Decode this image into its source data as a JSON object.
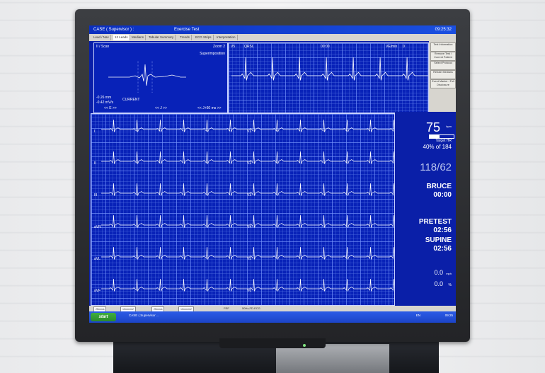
{
  "window": {
    "title_left": "CASE ( Supervisor ) :",
    "title_center": "Exercise Test",
    "clock": "09:25:32"
  },
  "tabs": [
    "Lead / Nav",
    "12 Leads",
    "Medians",
    "Tabular Summary",
    "Trends",
    "ECG Strips",
    "Interpretation"
  ],
  "sidebar_buttons": [
    "Test Information",
    "Remove Test / Current Patient",
    "Select Protocol",
    "Retrain Medians",
    "Event Marker / Full Disclosure"
  ],
  "top_left_panel": {
    "title": "II / Scan",
    "zoom": "Zoom 2",
    "superimposition": "Superimposition",
    "readout1": "-0.26 mm",
    "readout2": "-0.42 mV/s",
    "current": "CURRENT",
    "nav_e": "<<  E  >>",
    "nav_j": "<<  J  >>",
    "nav_j60": "<<  J+60 ms  >>"
  },
  "top_right_panel": {
    "lead": "V5",
    "qrs": "QRSL",
    "time": "00:00",
    "ve": "VE/min",
    "ve_value": "0"
  },
  "leads": [
    "I",
    "II",
    "III",
    "aVR",
    "aVL",
    "aVF"
  ],
  "lead_markers": [
    "V1",
    "V2",
    "V3",
    "V4",
    "V5",
    "V6"
  ],
  "vitals": {
    "heart_rate": "75",
    "hr_unit": "bpm",
    "target_label": "Target HR",
    "target_value": "40% of 184",
    "bp": "118/62",
    "protocol": "BRUCE",
    "protocol_time": "00:00",
    "stage": "PRETEST",
    "stage_time": "02:56",
    "position": "SUPINE",
    "position_time": "02:56",
    "speed": "0.0",
    "speed_unit": "mph",
    "grade": "0.0",
    "grade_unit": "%"
  },
  "status": {
    "combo1": "25mm/s",
    "combo2": "10mm/mV",
    "combo3": "25mm/s",
    "combo4": "10mm/mV",
    "filter": "FRF",
    "filter2": "50Hz,FD-ECG"
  },
  "taskbar": {
    "start": "start",
    "task": "CASE ( Supervisor ...",
    "lang": "EN",
    "time": "09:25"
  },
  "colors": {
    "screen_bg": "#0a1fa8",
    "trace": "#ffffff",
    "grid": "#7896ff"
  }
}
